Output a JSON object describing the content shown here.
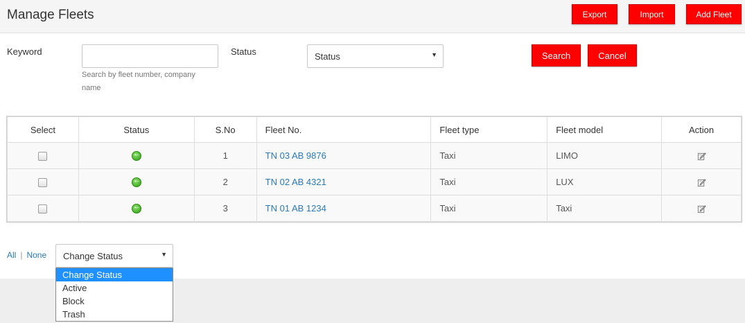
{
  "header": {
    "title": "Manage Fleets",
    "export_label": "Export",
    "import_label": "Import",
    "add_label": "Add Fleet"
  },
  "filters": {
    "keyword_label": "Keyword",
    "keyword_value": "",
    "keyword_help": "Search by fleet number, company name",
    "status_label": "Status",
    "status_selected": "Status",
    "search_label": "Search",
    "cancel_label": "Cancel"
  },
  "table": {
    "headers": [
      "Select",
      "Status",
      "S.No",
      "Fleet No.",
      "Fleet type",
      "Fleet model",
      "Action"
    ],
    "rows": [
      {
        "sno": "1",
        "fleet_no": "TN 03 AB 9876",
        "type": "Taxi",
        "model": "LIMO"
      },
      {
        "sno": "2",
        "fleet_no": "TN 02 AB 4321",
        "type": "Taxi",
        "model": "LUX"
      },
      {
        "sno": "3",
        "fleet_no": "TN 01 AB 1234",
        "type": "Taxi",
        "model": "Taxi"
      }
    ]
  },
  "bulk": {
    "all_label": "All",
    "sep": "|",
    "none_label": "None",
    "change_status_selected": "Change Status",
    "options": [
      "Change Status",
      "Active",
      "Block",
      "Trash"
    ]
  },
  "icons": {
    "status": "active-status-icon",
    "action": "edit-icon",
    "caret": "caret-down-icon"
  },
  "colors": {
    "button": "#ff0000",
    "link": "#2a7ab8",
    "selected_option": "#1e90ff",
    "active_status": "#2c9a14"
  }
}
